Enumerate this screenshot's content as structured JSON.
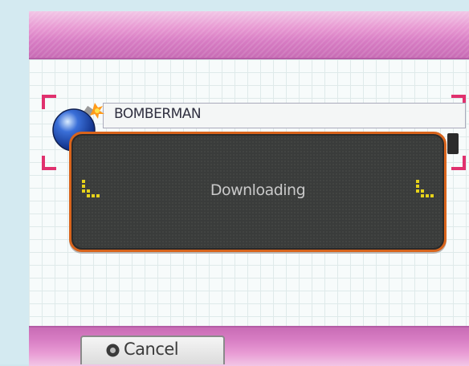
{
  "game": {
    "title": "BOMBERMAN",
    "icon": "bomb-icon"
  },
  "dialog": {
    "status_text": "Downloading",
    "icon": "loading-dots-icon"
  },
  "footer": {
    "cancel_label": "Cancel",
    "cancel_icon": "b-button-icon"
  },
  "colors": {
    "accent_pink": "#d77cc3",
    "selection_red": "#e0316e",
    "dialog_border": "#d8641c",
    "dialog_bg": "#3a3c3b",
    "loading_yellow": "#e6d21a"
  }
}
